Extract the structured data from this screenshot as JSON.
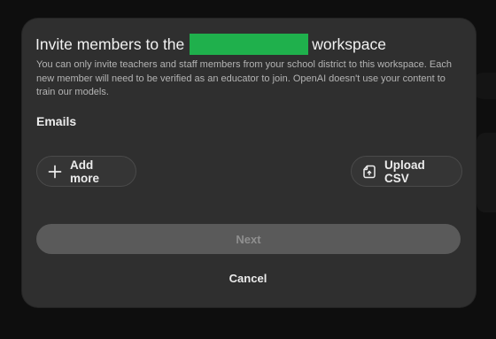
{
  "modal": {
    "title_prefix": "Invite members to the",
    "title_suffix": "workspace",
    "description": "You can only invite teachers and staff members from your school district to this workspace. Each new member will need to be verified as an educator to join. OpenAI doesn't use your content to train our models.",
    "emails_label": "Emails",
    "add_more_label": "Add more",
    "add_more_icon": "plus-icon",
    "upload_csv_label": "Upload CSV",
    "upload_csv_icon": "file-upload-icon",
    "next_label": "Next",
    "cancel_label": "Cancel"
  },
  "colors": {
    "modal_bg": "#2f2f2f",
    "redaction": "#1fb04c",
    "disabled_button": "#5a5a5a"
  }
}
